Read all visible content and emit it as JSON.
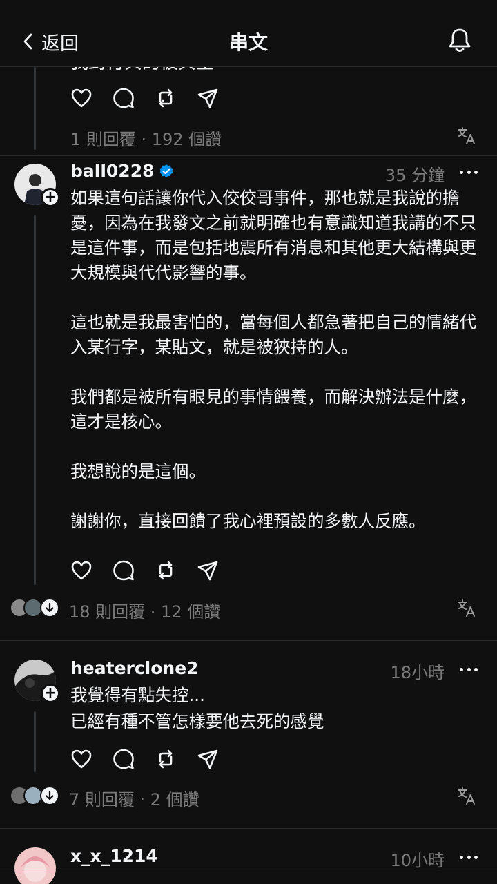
{
  "header": {
    "back_label": "返回",
    "title": "串文"
  },
  "peek": {
    "text": "我對付與的被與生"
  },
  "first_post": {
    "stats": "1 則回覆 · 192 個讚"
  },
  "posts": [
    {
      "username": "ball0228",
      "verified": true,
      "time": "35 分鐘",
      "body": "如果這句話讓你代入佼佼哥事件，那也就是我說的擔憂，因為在我發文之前就明確也有意識知道我講的不只是這件事，而是包括地震所有消息和其他更大結構與更大規模與代代影響的事。\n\n這也就是我最害怕的，當每個人都急著把自己的情緒代入某行字，某貼文，就是被狹持的人。\n\n我們都是被所有眼見的事情餵養，而解決辦法是什麼，這才是核心。\n\n我想說的是這個。\n\n謝謝你，直接回饋了我心裡預設的多數人反應。",
      "stats": "18 則回覆 · 12 個讚"
    },
    {
      "username": "heaterclone2",
      "verified": false,
      "time": "18小時",
      "body": "我覺得有點失控...\n已經有種不管怎樣要他去死的感覺",
      "stats": "7 則回覆 · 2 個讚"
    },
    {
      "username": "x_x_1214",
      "verified": false,
      "time": "10小時"
    }
  ],
  "colors": {
    "background": "#101010",
    "text": "#f3f5f7",
    "muted": "#7a7a7a",
    "verified": "#0095f6"
  },
  "icons": [
    "back-chevron-icon",
    "bell-icon",
    "heart-icon",
    "comment-icon",
    "repost-icon",
    "share-icon",
    "translate-icon",
    "more-icon",
    "verified-icon"
  ]
}
